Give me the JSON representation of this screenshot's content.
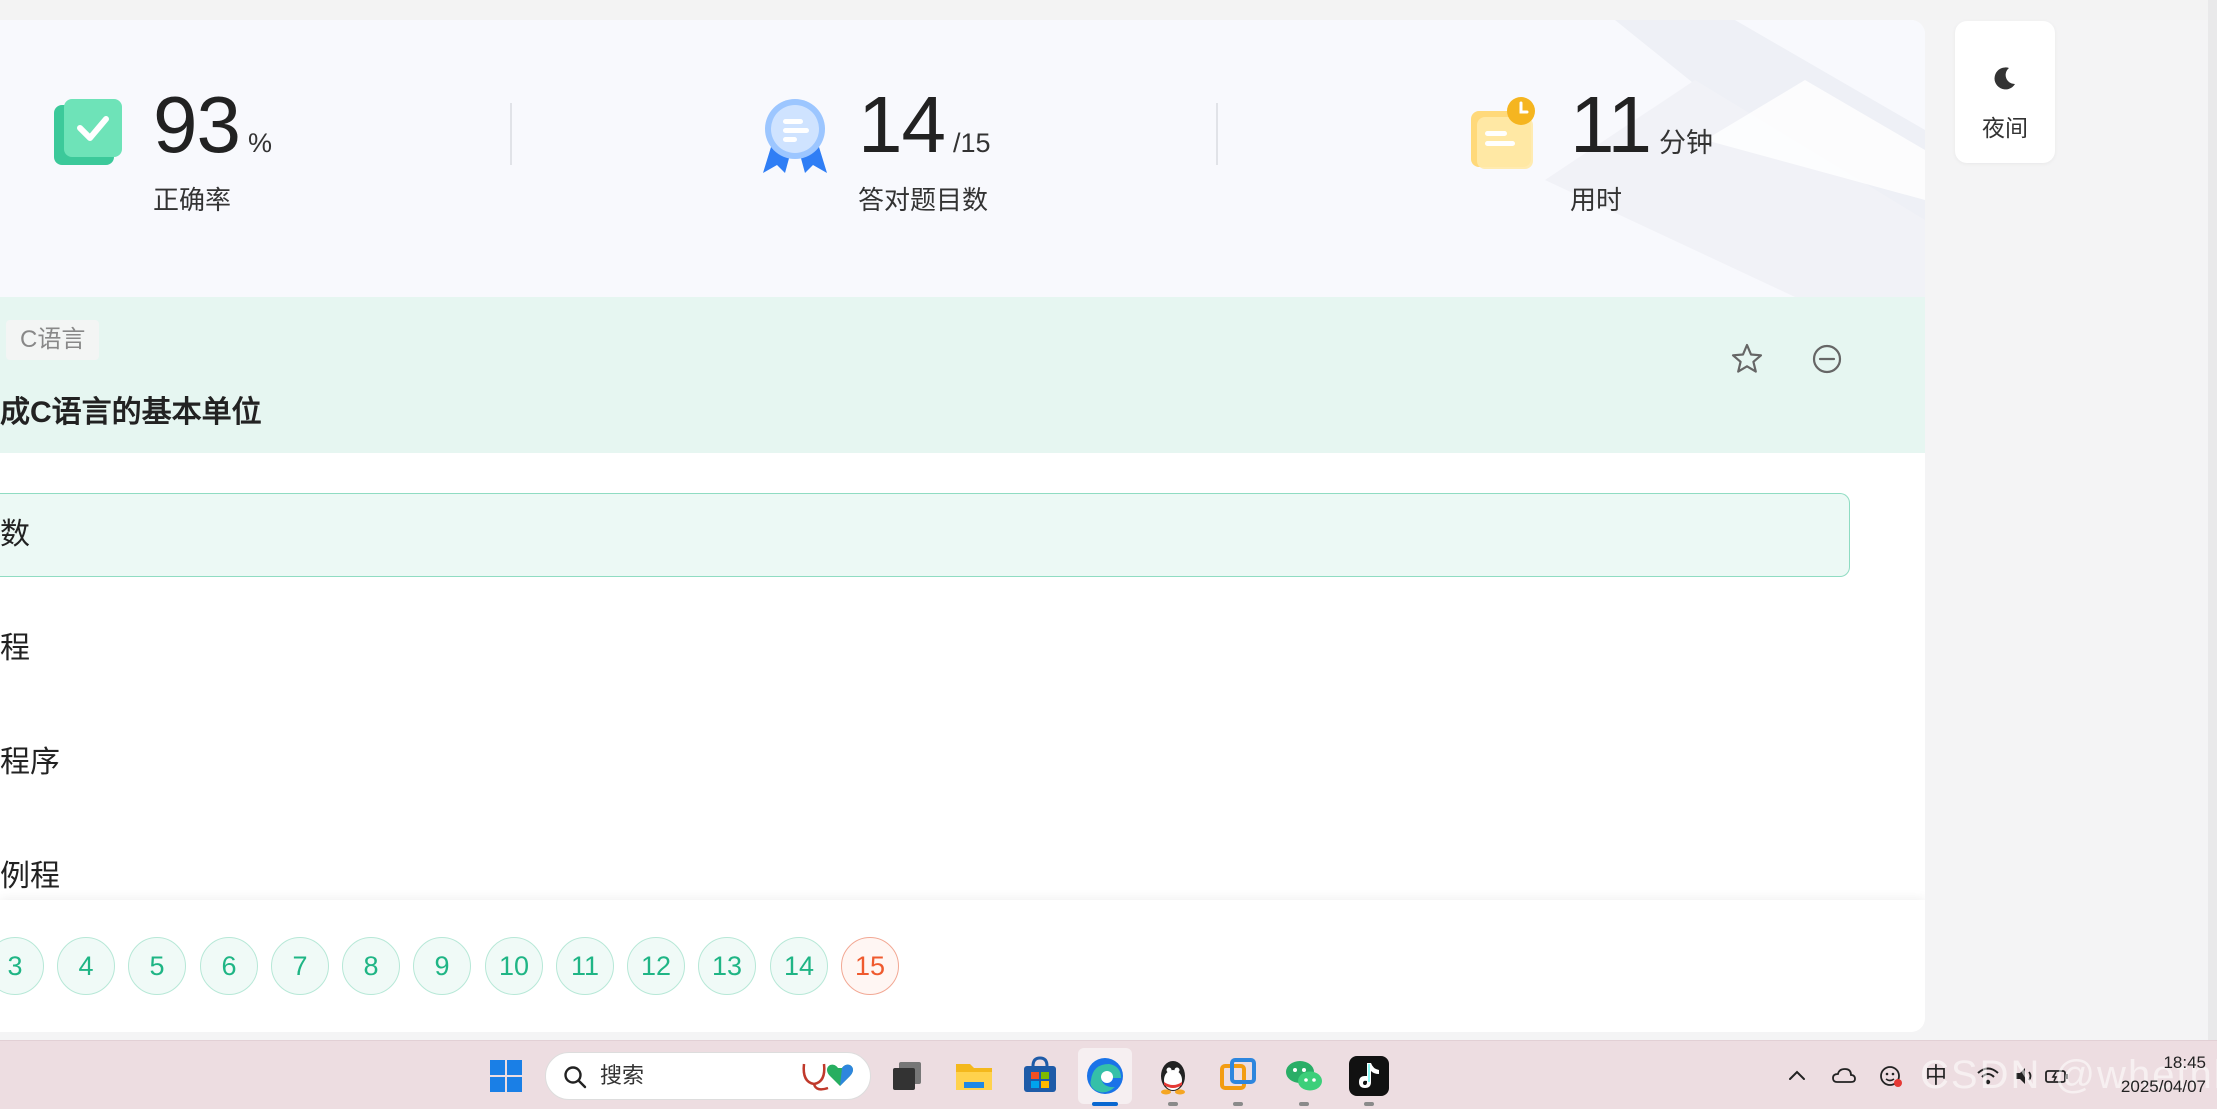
{
  "stats": {
    "accuracy": {
      "value": "93",
      "unit": "%",
      "label": "正确率"
    },
    "correct": {
      "value": "14",
      "unit": "/15",
      "label": "答对题目数"
    },
    "time": {
      "value": "11",
      "unit": "分钟",
      "label": "用时"
    }
  },
  "night_button": {
    "label": "夜间",
    "icon": "moon-icon"
  },
  "question": {
    "tag": "C语言",
    "title": "成C语言的基本单位",
    "options": [
      {
        "text": "数",
        "selected": true
      },
      {
        "text": "程",
        "selected": false
      },
      {
        "text": "程序",
        "selected": false
      },
      {
        "text": "例程",
        "selected": false
      }
    ]
  },
  "pager": {
    "items": [
      {
        "label": "3",
        "status": "correct"
      },
      {
        "label": "4",
        "status": "correct"
      },
      {
        "label": "5",
        "status": "correct"
      },
      {
        "label": "6",
        "status": "correct"
      },
      {
        "label": "7",
        "status": "correct"
      },
      {
        "label": "8",
        "status": "correct"
      },
      {
        "label": "9",
        "status": "correct"
      },
      {
        "label": "10",
        "status": "correct"
      },
      {
        "label": "11",
        "status": "correct"
      },
      {
        "label": "12",
        "status": "correct"
      },
      {
        "label": "13",
        "status": "correct"
      },
      {
        "label": "14",
        "status": "correct"
      },
      {
        "label": "15",
        "status": "wrong"
      }
    ]
  },
  "taskbar": {
    "search_placeholder": "搜索",
    "time": "18:45",
    "date": "2025/04/07",
    "watermark": "CSDN @whethl",
    "ime": "中",
    "apps": [
      "windows-start-icon",
      "task-view-icon",
      "file-explorer-icon",
      "microsoft-store-icon",
      "edge-browser-icon",
      "qq-icon",
      "vmware-icon",
      "wechat-icon",
      "tiktok-icon"
    ]
  },
  "colors": {
    "accent_green": "#1fb585",
    "wrong_red": "#ef5a2e",
    "header_bg": "#e6f6f1"
  }
}
